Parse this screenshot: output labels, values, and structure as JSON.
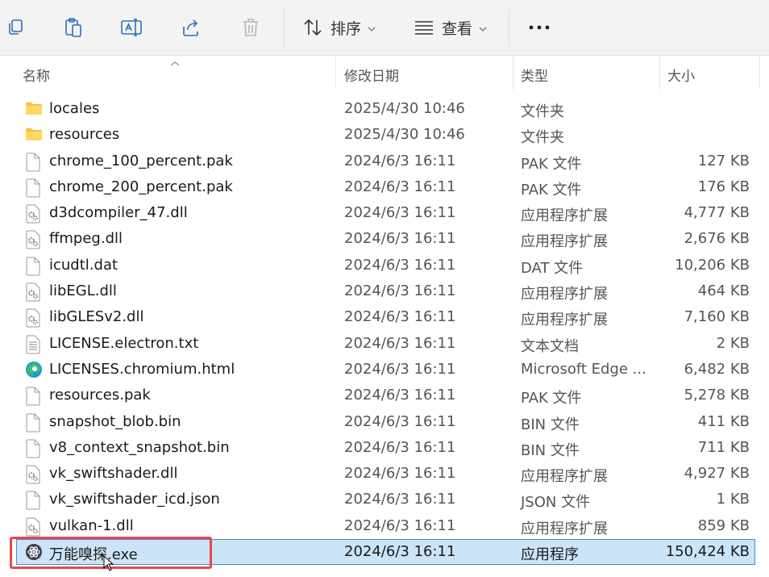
{
  "toolbar": {
    "sort_label": "排序",
    "view_label": "查看"
  },
  "columns": {
    "name": "名称",
    "date": "修改日期",
    "type": "类型",
    "size": "大小"
  },
  "files": [
    {
      "icon": "folder-icon",
      "name": "locales",
      "date": "2025/4/30 10:46",
      "type": "文件夹",
      "size": ""
    },
    {
      "icon": "folder-icon",
      "name": "resources",
      "date": "2025/4/30 10:46",
      "type": "文件夹",
      "size": ""
    },
    {
      "icon": "file-icon",
      "name": "chrome_100_percent.pak",
      "date": "2024/6/3 16:11",
      "type": "PAK 文件",
      "size": "127 KB"
    },
    {
      "icon": "file-icon",
      "name": "chrome_200_percent.pak",
      "date": "2024/6/3 16:11",
      "type": "PAK 文件",
      "size": "176 KB"
    },
    {
      "icon": "dll-icon",
      "name": "d3dcompiler_47.dll",
      "date": "2024/6/3 16:11",
      "type": "应用程序扩展",
      "size": "4,777 KB"
    },
    {
      "icon": "dll-icon",
      "name": "ffmpeg.dll",
      "date": "2024/6/3 16:11",
      "type": "应用程序扩展",
      "size": "2,676 KB"
    },
    {
      "icon": "file-icon",
      "name": "icudtl.dat",
      "date": "2024/6/3 16:11",
      "type": "DAT 文件",
      "size": "10,206 KB"
    },
    {
      "icon": "dll-icon",
      "name": "libEGL.dll",
      "date": "2024/6/3 16:11",
      "type": "应用程序扩展",
      "size": "464 KB"
    },
    {
      "icon": "dll-icon",
      "name": "libGLESv2.dll",
      "date": "2024/6/3 16:11",
      "type": "应用程序扩展",
      "size": "7,160 KB"
    },
    {
      "icon": "text-file-icon",
      "name": "LICENSE.electron.txt",
      "date": "2024/6/3 16:11",
      "type": "文本文档",
      "size": "2 KB"
    },
    {
      "icon": "edge-icon",
      "name": "LICENSES.chromium.html",
      "date": "2024/6/3 16:11",
      "type": "Microsoft Edge ...",
      "size": "6,482 KB"
    },
    {
      "icon": "file-icon",
      "name": "resources.pak",
      "date": "2024/6/3 16:11",
      "type": "PAK 文件",
      "size": "5,278 KB"
    },
    {
      "icon": "file-icon",
      "name": "snapshot_blob.bin",
      "date": "2024/6/3 16:11",
      "type": "BIN 文件",
      "size": "411 KB"
    },
    {
      "icon": "file-icon",
      "name": "v8_context_snapshot.bin",
      "date": "2024/6/3 16:11",
      "type": "BIN 文件",
      "size": "711 KB"
    },
    {
      "icon": "dll-icon",
      "name": "vk_swiftshader.dll",
      "date": "2024/6/3 16:11",
      "type": "应用程序扩展",
      "size": "4,927 KB"
    },
    {
      "icon": "file-icon",
      "name": "vk_swiftshader_icd.json",
      "date": "2024/6/3 16:11",
      "type": "JSON 文件",
      "size": "1 KB"
    },
    {
      "icon": "dll-icon",
      "name": "vulkan-1.dll",
      "date": "2024/6/3 16:11",
      "type": "应用程序扩展",
      "size": "859 KB"
    },
    {
      "icon": "app-icon",
      "name": "万能嗅探.exe",
      "date": "2024/6/3 16:11",
      "type": "应用程序",
      "size": "150,424 KB",
      "selected": true
    }
  ],
  "colors": {
    "selection_bg": "#cce4f7",
    "selection_border": "#4d88c7",
    "highlight": "#e5484d",
    "folder": "#f5c242"
  }
}
